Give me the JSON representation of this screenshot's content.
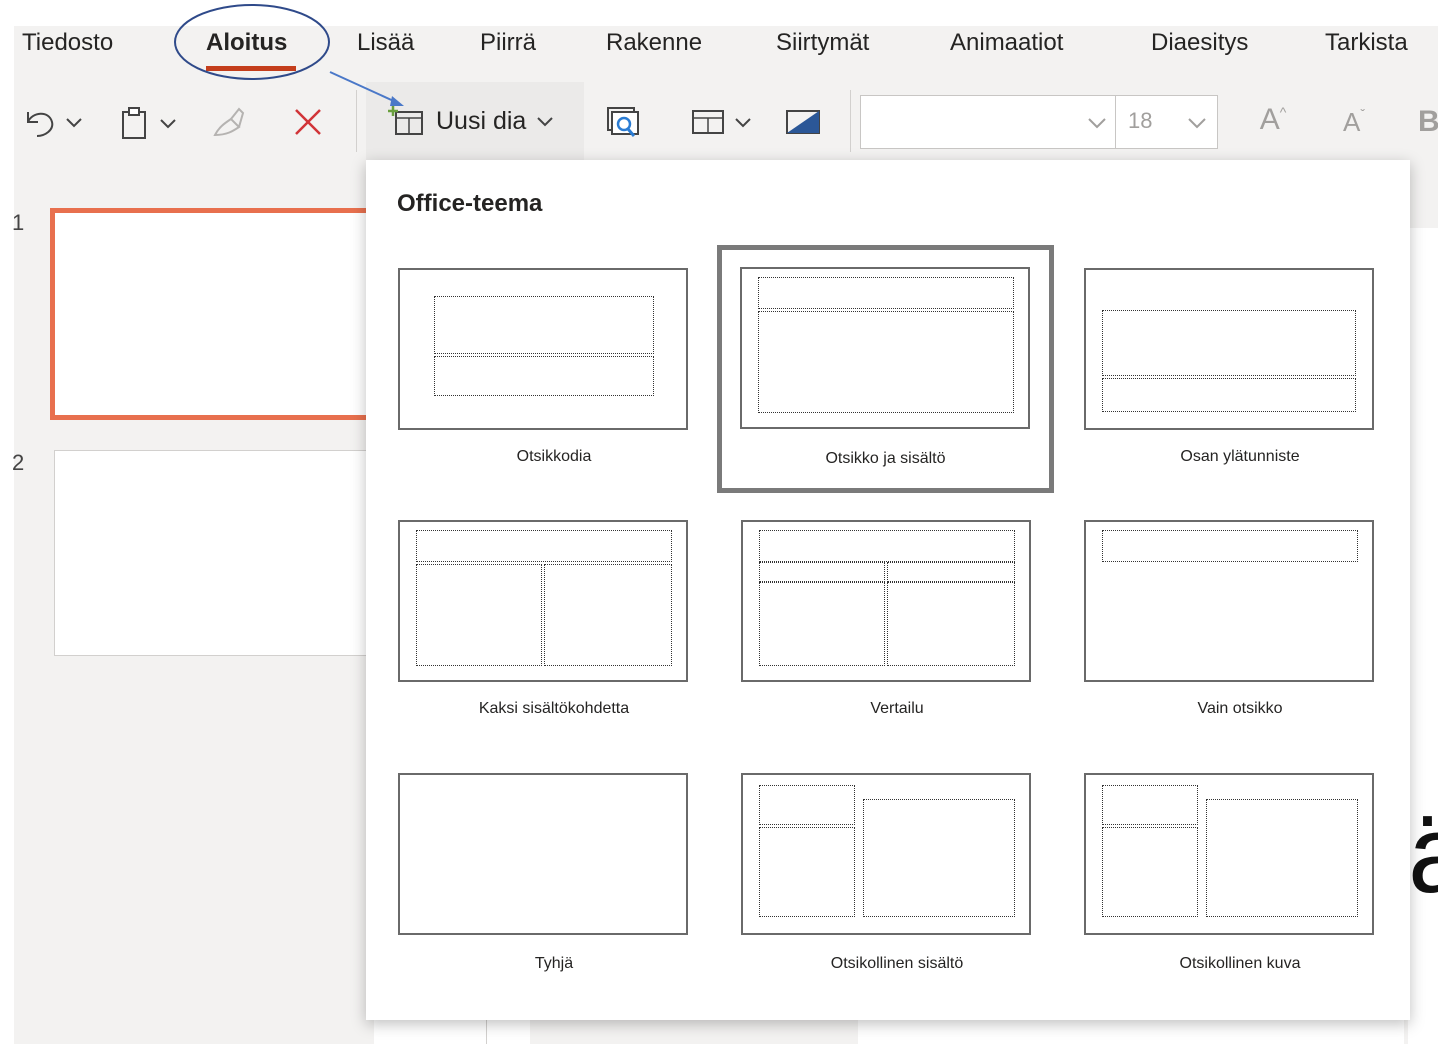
{
  "ribbon": {
    "tabs": [
      "Tiedosto",
      "Aloitus",
      "Lisää",
      "Piirrä",
      "Rakenne",
      "Siirtymät",
      "Animaatiot",
      "Diaesitys",
      "Tarkista"
    ],
    "active_tab": "Aloitus"
  },
  "toolbar": {
    "new_slide_label": "Uusi dia",
    "font_name": "",
    "font_size": "18",
    "grow_font_glyph": "A",
    "shrink_font_glyph": "A",
    "bold_glyph": "B"
  },
  "slides_panel": {
    "slide_numbers": [
      "1",
      "2"
    ],
    "selected_slide": "1"
  },
  "layout_gallery": {
    "theme_title": "Office-teema",
    "selected_layout": "Otsikko ja sisältö",
    "layouts": [
      "Otsikkodia",
      "Otsikko ja sisältö",
      "Osan ylätunniste",
      "Kaksi sisältökohdetta",
      "Vertailu",
      "Vain otsikko",
      "Tyhjä",
      "Otsikollinen sisältö",
      "Otsikollinen kuva"
    ]
  },
  "editor": {
    "partial_glyph": "ä"
  },
  "annotations": {
    "circle_color": "#2f4a8a",
    "arrow_color": "#4a78c8"
  },
  "colors": {
    "accent": "#c43e1c",
    "selected_slide_border": "#e8704e",
    "delete_icon": "#d13438"
  }
}
